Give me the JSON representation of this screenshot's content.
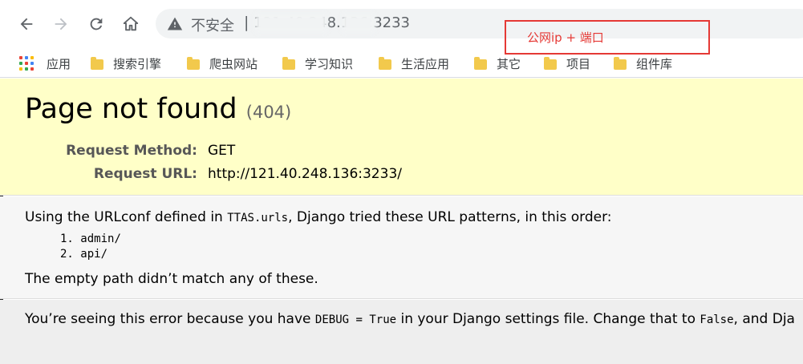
{
  "browser": {
    "omnibox": {
      "security_label": "不安全",
      "separator": "|",
      "url_visible": "121.40.248.136:3233"
    },
    "bookmarks": [
      {
        "label": "应用",
        "icon": "apps-grid-icon"
      },
      {
        "label": "搜索引擎",
        "icon": "folder-icon"
      },
      {
        "label": "爬虫网站",
        "icon": "folder-icon"
      },
      {
        "label": "学习知识",
        "icon": "folder-icon"
      },
      {
        "label": "生活应用",
        "icon": "folder-icon"
      },
      {
        "label": "其它",
        "icon": "folder-icon"
      },
      {
        "label": "项目",
        "icon": "folder-icon"
      },
      {
        "label": "组件库",
        "icon": "folder-icon"
      }
    ],
    "colors": {
      "folder": "#f2c94c",
      "omnibox_bg": "#f1f3f4",
      "annotation": "#e53935"
    }
  },
  "annotation": {
    "text": "公网ip + 端口"
  },
  "page": {
    "title": "Page not found",
    "status_code": "(404)",
    "request_method_label": "Request Method:",
    "request_method_value": "GET",
    "request_url_label": "Request URL:",
    "request_url_value": "http://121.40.248.136:3233/",
    "info_prefix": "Using the URLconf defined in ",
    "urlconf": "TTAS.urls",
    "info_suffix": ", Django tried these URL patterns, in this order:",
    "patterns": [
      {
        "num": "1.",
        "value": "admin/"
      },
      {
        "num": "2.",
        "value": "api/"
      }
    ],
    "no_match": "The empty path didn’t match any of these.",
    "explain_1": "You’re seeing this error because you have ",
    "explain_debug": "DEBUG = True",
    "explain_2": " in your Django settings file. Change that to ",
    "explain_false": "False",
    "explain_3": ", and Dja",
    "colors": {
      "summary_bg": "#ffffc8",
      "info_bg": "#f6f6f6",
      "explanation_bg": "#eeeeee",
      "label": "#575757"
    }
  }
}
